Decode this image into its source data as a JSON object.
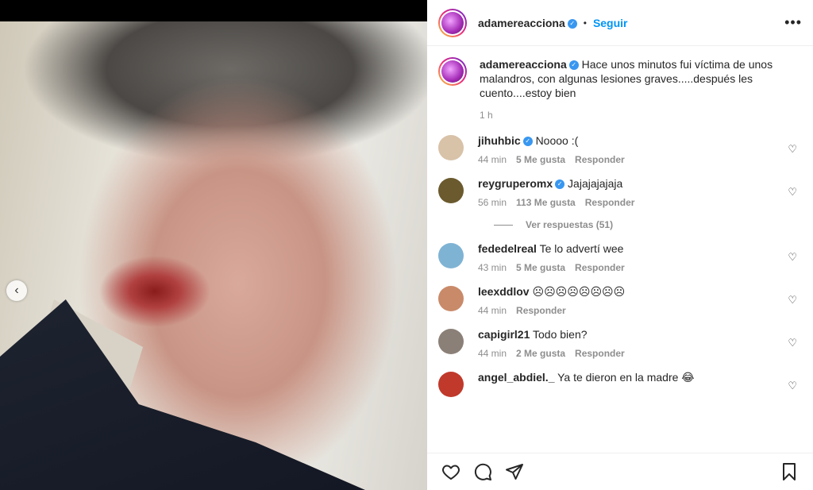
{
  "post": {
    "username": "adamereacciona",
    "follow_label": "Seguir",
    "caption": "Hace unos minutos fui víctima de unos malandros, con algunas lesiones graves.....después les cuento....estoy bien",
    "time": "1 h"
  },
  "comments": [
    {
      "user": "jihuhbic",
      "verified": true,
      "text": "Noooo :(",
      "time": "44 min",
      "likes": "5 Me gusta",
      "reply": "Responder",
      "avatar_color": "#d8c2a8"
    },
    {
      "user": "reygruperomx",
      "verified": true,
      "text": "Jajajajajaja",
      "time": "56 min",
      "likes": "113 Me gusta",
      "reply": "Responder",
      "avatar_color": "#6b5a2e"
    },
    {
      "user": "fededelreal",
      "verified": false,
      "text": "Te lo advertí wee",
      "time": "43 min",
      "likes": "5 Me gusta",
      "reply": "Responder",
      "avatar_color": "#7fb3d3"
    },
    {
      "user": "leexddlov",
      "verified": false,
      "text": "☹☹☹☹☹☹☹☹",
      "time": "44 min",
      "likes": "",
      "reply": "Responder",
      "avatar_color": "#c98a6a"
    },
    {
      "user": "capigirl21",
      "verified": false,
      "text": "Todo bien?",
      "time": "44 min",
      "likes": "2 Me gusta",
      "reply": "Responder",
      "avatar_color": "#8b8077"
    },
    {
      "user": "angel_abdiel._",
      "verified": false,
      "text": "Ya te dieron en la madre 😂",
      "time": "",
      "likes": "",
      "reply": "",
      "avatar_color": "#c0392b"
    }
  ],
  "view_replies": "Ver respuestas (51)",
  "icons": {
    "like": "heart-icon",
    "comment": "comment-icon",
    "share": "share-icon",
    "save": "bookmark-icon",
    "more": "more-options-icon",
    "prev": "chevron-left-icon"
  },
  "colors": {
    "accent": "#0095f6",
    "verified": "#3897f0"
  }
}
